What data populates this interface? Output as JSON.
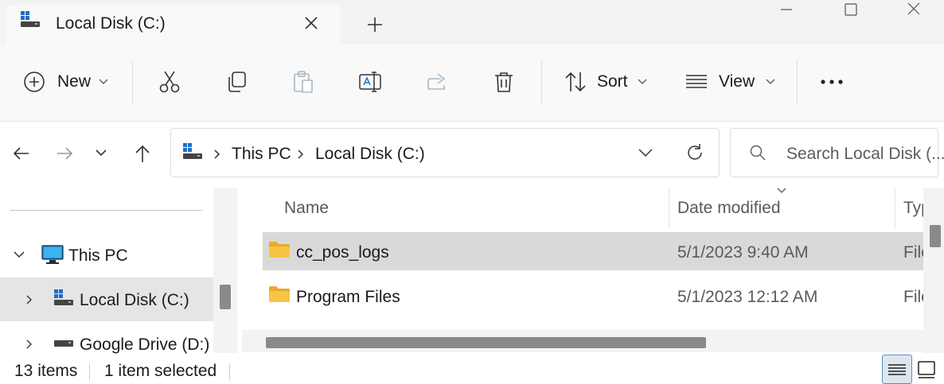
{
  "window": {
    "tab_title": "Local Disk (C:)"
  },
  "toolbar": {
    "new_label": "New",
    "sort_label": "Sort",
    "view_label": "View"
  },
  "address": {
    "crumbs": [
      "This PC",
      "Local Disk (C:)"
    ]
  },
  "search": {
    "placeholder": "Search Local Disk (..."
  },
  "nav": {
    "items": [
      {
        "label": "This PC",
        "expanded": true
      },
      {
        "label": "Local Disk (C:)",
        "selected": true
      },
      {
        "label": "Google Drive (D:)"
      }
    ]
  },
  "columns": {
    "name": "Name",
    "date_modified": "Date modified",
    "type": "Typ"
  },
  "files": [
    {
      "name": "cc_pos_logs",
      "date": "5/1/2023 9:40 AM",
      "type": "File",
      "selected": true
    },
    {
      "name": "Program Files",
      "date": "5/1/2023 12:12 AM",
      "type": "File",
      "selected": false
    }
  ],
  "status": {
    "item_count": "13 items",
    "selection": "1 item selected"
  },
  "icons": {
    "drive": "drive-icon",
    "folder": "folder-icon",
    "monitor": "this-pc-icon"
  },
  "colors": {
    "folder_yellow": "#f8c443",
    "selection_gray": "#d9d9d9",
    "accent_blue": "#2f72c4"
  }
}
